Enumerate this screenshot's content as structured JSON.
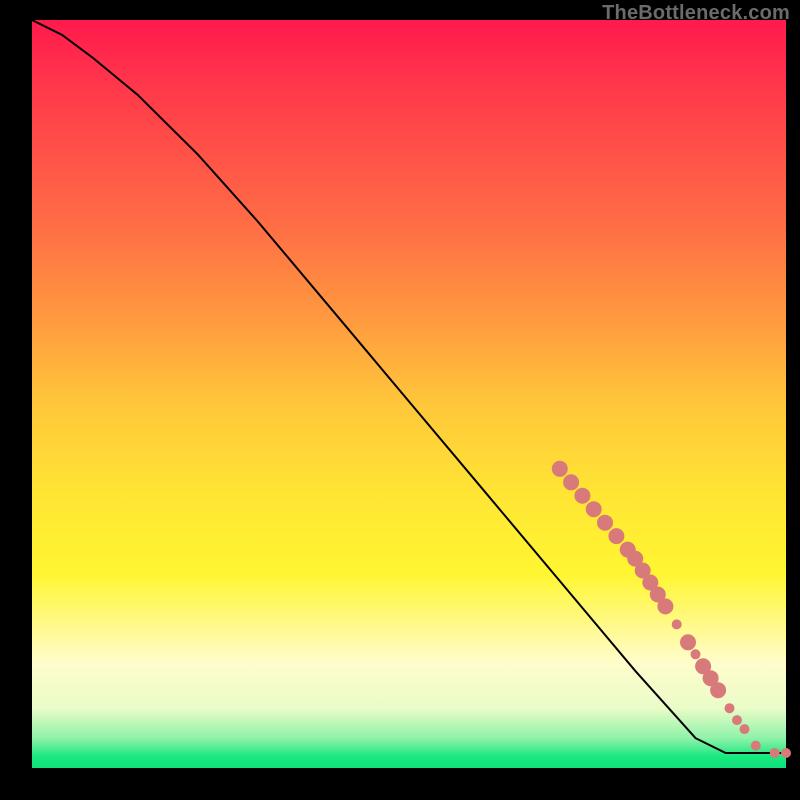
{
  "watermark": "TheBottleneck.com",
  "chart_data": {
    "type": "line",
    "title": "",
    "xlabel": "",
    "ylabel": "",
    "xlim": [
      0,
      100
    ],
    "ylim": [
      0,
      100
    ],
    "grid": false,
    "legend": false,
    "series": [
      {
        "name": "bottleneck-curve",
        "x": [
          0,
          4,
          8,
          14,
          22,
          30,
          40,
          50,
          60,
          70,
          80,
          88,
          92,
          96,
          100
        ],
        "y": [
          100,
          98,
          95,
          90,
          82,
          73,
          61,
          49,
          37,
          25,
          13,
          4,
          2,
          2,
          2
        ]
      }
    ],
    "markers": {
      "name": "highlight-points",
      "color": "#d97a7a",
      "radius_small": 5,
      "radius_large": 8,
      "points": [
        {
          "x": 70.0,
          "y": 40.0,
          "r": "large"
        },
        {
          "x": 71.5,
          "y": 38.2,
          "r": "large"
        },
        {
          "x": 73.0,
          "y": 36.4,
          "r": "large"
        },
        {
          "x": 74.5,
          "y": 34.6,
          "r": "large"
        },
        {
          "x": 76.0,
          "y": 32.8,
          "r": "large"
        },
        {
          "x": 77.5,
          "y": 31.0,
          "r": "large"
        },
        {
          "x": 79.0,
          "y": 29.2,
          "r": "large"
        },
        {
          "x": 80.0,
          "y": 28.0,
          "r": "large"
        },
        {
          "x": 81.0,
          "y": 26.4,
          "r": "large"
        },
        {
          "x": 82.0,
          "y": 24.8,
          "r": "large"
        },
        {
          "x": 83.0,
          "y": 23.2,
          "r": "large"
        },
        {
          "x": 84.0,
          "y": 21.6,
          "r": "large"
        },
        {
          "x": 85.5,
          "y": 19.2,
          "r": "small"
        },
        {
          "x": 87.0,
          "y": 16.8,
          "r": "large"
        },
        {
          "x": 88.0,
          "y": 15.2,
          "r": "small"
        },
        {
          "x": 89.0,
          "y": 13.6,
          "r": "large"
        },
        {
          "x": 90.0,
          "y": 12.0,
          "r": "large"
        },
        {
          "x": 91.0,
          "y": 10.4,
          "r": "large"
        },
        {
          "x": 92.5,
          "y": 8.0,
          "r": "small"
        },
        {
          "x": 93.5,
          "y": 6.4,
          "r": "small"
        },
        {
          "x": 94.5,
          "y": 5.2,
          "r": "small"
        },
        {
          "x": 96.0,
          "y": 3.0,
          "r": "small"
        },
        {
          "x": 98.5,
          "y": 2.0,
          "r": "small"
        },
        {
          "x": 100.0,
          "y": 2.0,
          "r": "small"
        }
      ]
    }
  }
}
